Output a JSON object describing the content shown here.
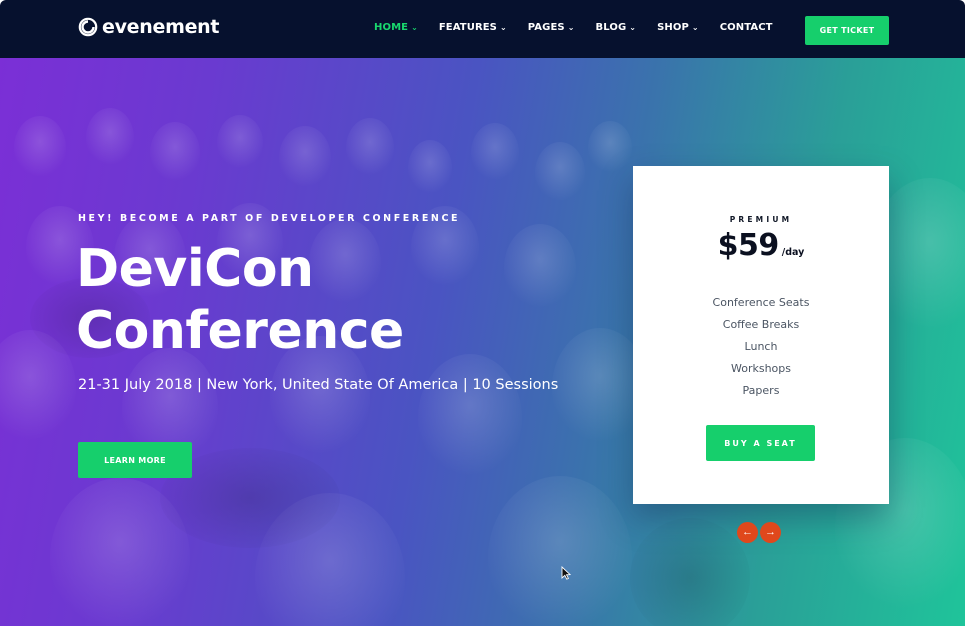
{
  "header": {
    "logo_text": "evenement",
    "nav": [
      {
        "label": "HOME",
        "active": true,
        "has_dropdown": true
      },
      {
        "label": "FEATURES",
        "active": false,
        "has_dropdown": true
      },
      {
        "label": "PAGES",
        "active": false,
        "has_dropdown": true
      },
      {
        "label": "BLOG",
        "active": false,
        "has_dropdown": true
      },
      {
        "label": "SHOP",
        "active": false,
        "has_dropdown": true
      },
      {
        "label": "CONTACT",
        "active": false,
        "has_dropdown": false
      }
    ],
    "cta_label": "GET TICKET"
  },
  "hero": {
    "kicker": "HEY! BECOME A PART OF DEVELOPER CONFERENCE",
    "title_line1": "DeviCon",
    "title_line2": "Conference",
    "subtitle": "21-31 July 2018 | New York, United State Of America | 10 Sessions",
    "button_label": "LEARN MORE"
  },
  "pricing": {
    "plan": "PREMIUM",
    "price": "$59",
    "period": "/day",
    "features": [
      "Conference Seats",
      "Coffee Breaks",
      "Lunch",
      "Workshops",
      "Papers"
    ],
    "button_label": "BUY A SEAT"
  },
  "slider": {
    "prev_icon": "arrow-left-icon",
    "next_icon": "arrow-right-icon"
  },
  "colors": {
    "nav_bg": "#06112e",
    "accent_green": "#16cf6c",
    "arrow_orange": "#e0481c",
    "gradient_start": "#7b2fd6",
    "gradient_end": "#1fc49a"
  }
}
